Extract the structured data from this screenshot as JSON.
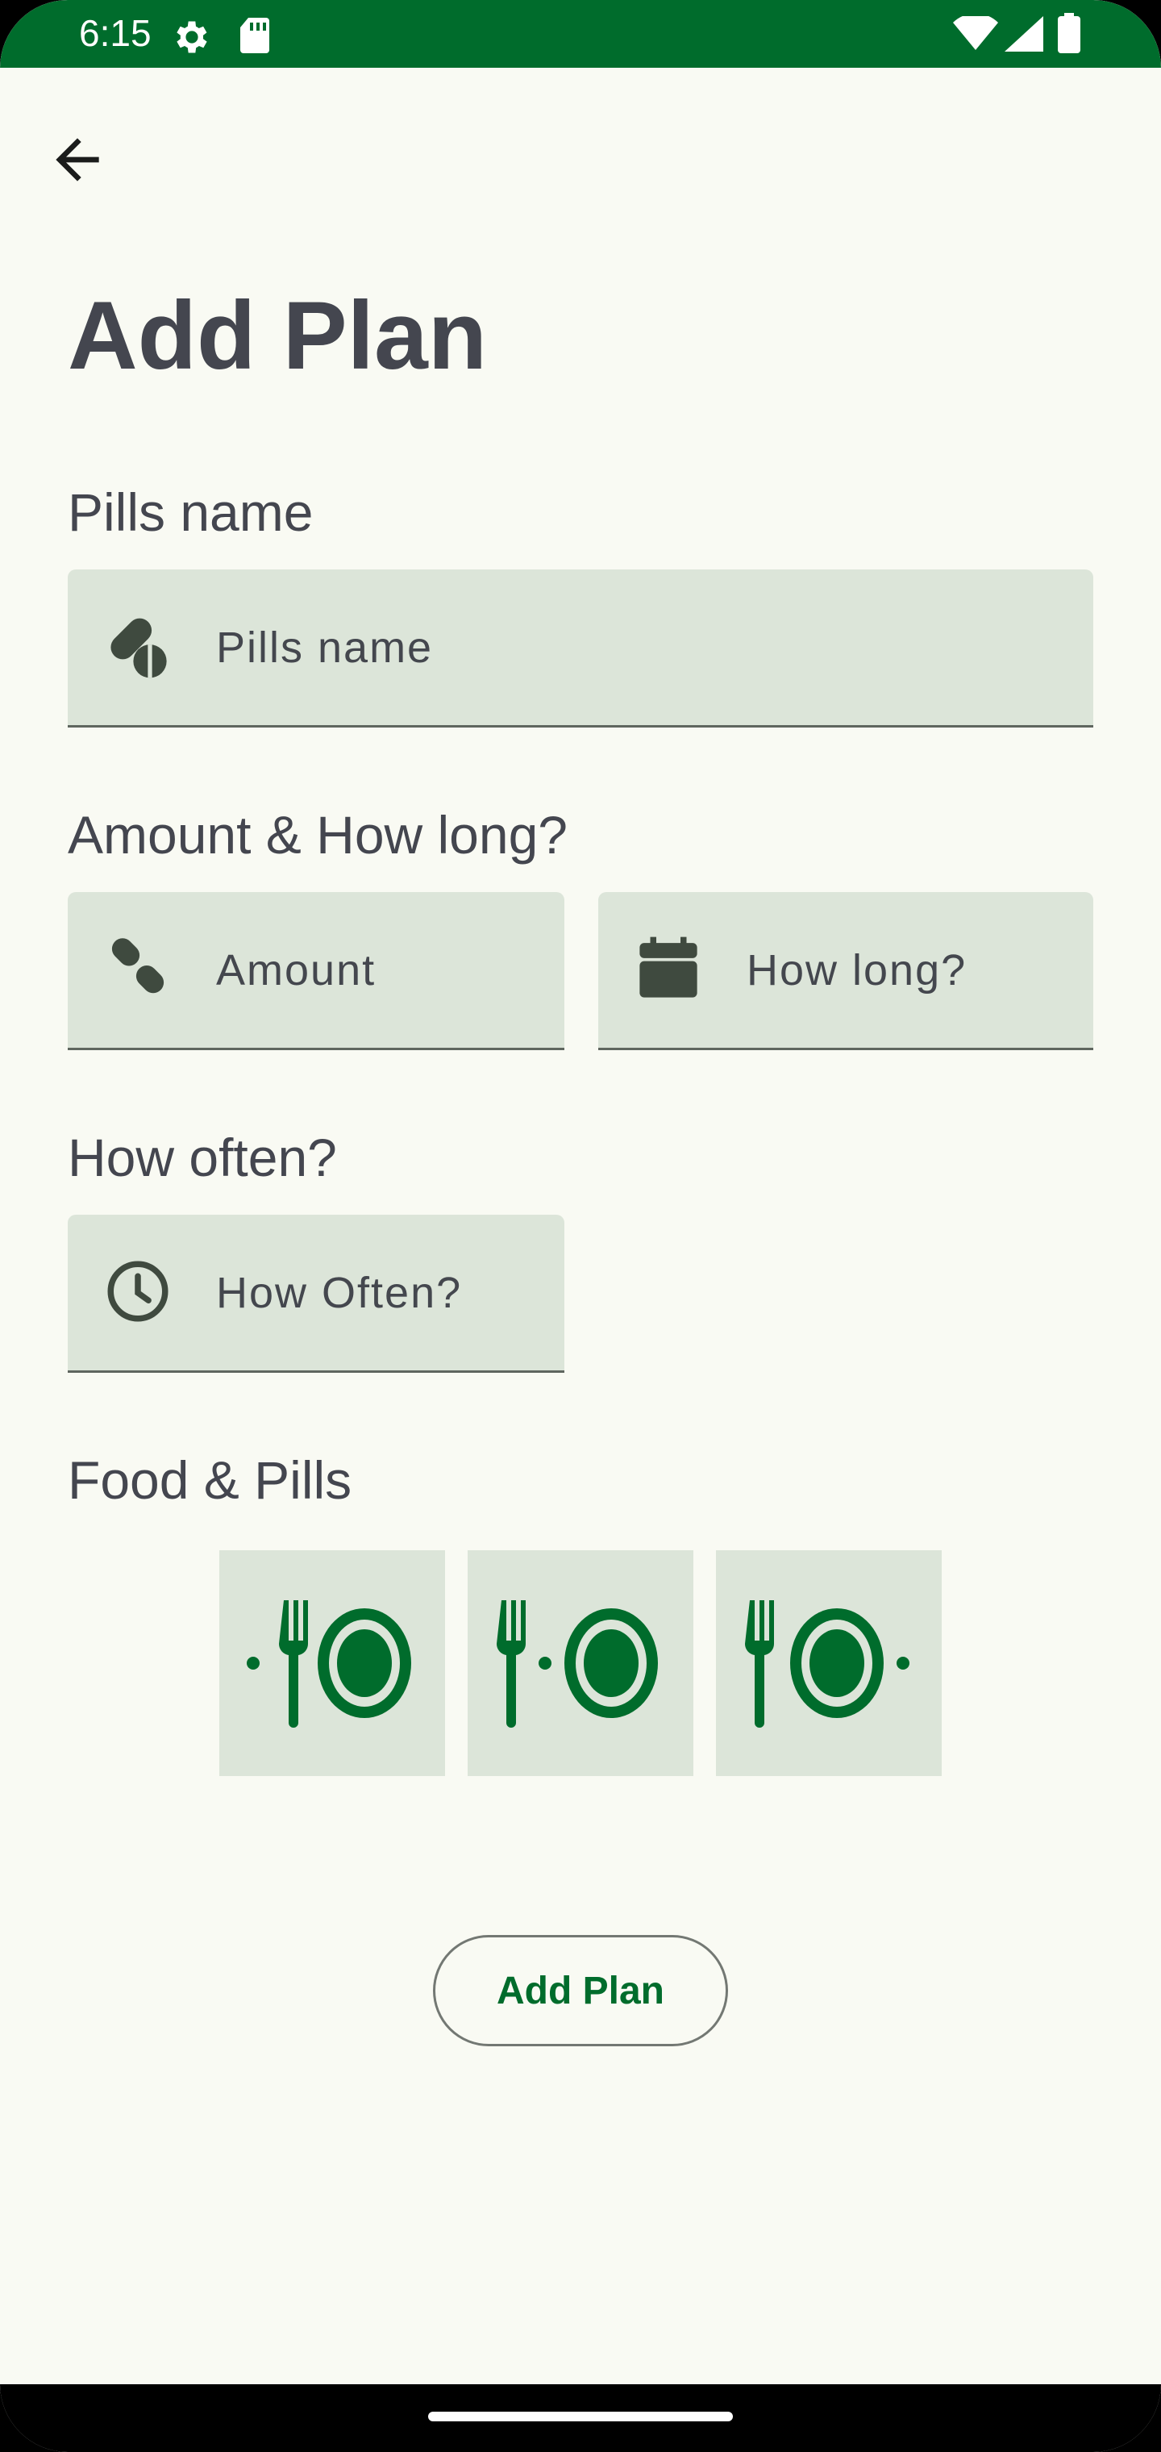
{
  "status_bar": {
    "time": "6:15",
    "icons": [
      "settings-icon",
      "sd-card-icon",
      "wifi-icon",
      "signal-icon",
      "battery-icon"
    ]
  },
  "header": {
    "back_icon": "arrow-back-icon",
    "title": "Add Plan"
  },
  "sections": {
    "pills_name_label": "Pills name",
    "amount_label": "Amount & How long?",
    "how_often_label": "How often?",
    "food_label": "Food & Pills"
  },
  "fields": {
    "pills_name": {
      "placeholder": "Pills name",
      "icon": "pills-icon"
    },
    "amount": {
      "placeholder": "Amount",
      "icon": "capsules-icon"
    },
    "how_long": {
      "placeholder": "How long?",
      "icon": "calendar-icon"
    },
    "how_often": {
      "placeholder": "How Often?",
      "icon": "clock-icon"
    }
  },
  "food_options": [
    {
      "icon": "before-food-icon"
    },
    {
      "icon": "with-food-icon"
    },
    {
      "icon": "after-food-icon"
    }
  ],
  "actions": {
    "add_plan_label": "Add Plan"
  },
  "colors": {
    "primary": "#006c2c",
    "background": "#f9faf3",
    "field_fill": "#dce5d9",
    "text": "#44464f"
  }
}
